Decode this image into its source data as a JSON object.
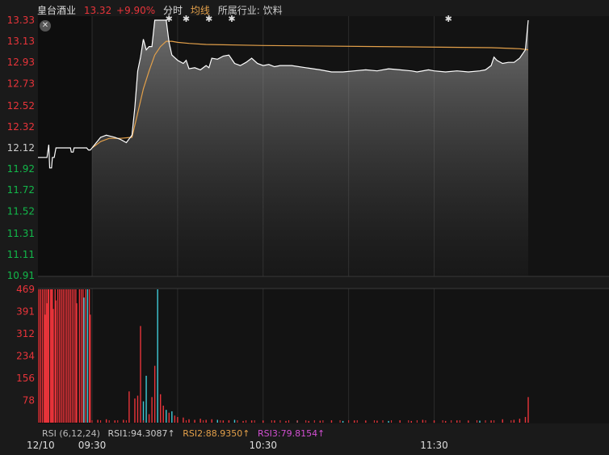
{
  "header": {
    "name": "皇台酒业",
    "price": "13.32",
    "change": "+9.90%",
    "mode": "分时",
    "avg_label": "均线",
    "industry": "所属行业: 饮料"
  },
  "rsi": {
    "label": "RSI (6,12,24)",
    "rsi1": "RSI1:94.3087↑",
    "rsi2": "RSI2:88.9350↑",
    "rsi3": "RSI3:79.8154↑"
  },
  "icons": {
    "close": "close-icon"
  },
  "colors": {
    "up": "#e8343a",
    "down": "#12b84a",
    "price": "#ffffff",
    "avg": "#e3a04a",
    "rsi1": "#cccccc",
    "rsi2": "#e3a04a",
    "rsi3": "#d24fd2",
    "volcyan": "#3fc9d6"
  },
  "chart_data": {
    "type": "line",
    "date_label": "12/10",
    "prev_close": "12.12",
    "y_ticks": [
      "13.33",
      "13.13",
      "12.93",
      "12.73",
      "12.52",
      "12.32",
      "12.12",
      "11.92",
      "11.72",
      "11.52",
      "11.31",
      "11.11",
      "10.91"
    ],
    "y_up": [
      "13.33",
      "13.13",
      "12.93",
      "12.73",
      "12.52",
      "12.32"
    ],
    "y_down": [
      "11.92",
      "11.72",
      "11.52",
      "11.31",
      "11.11",
      "10.91"
    ],
    "ylim": [
      10.91,
      13.33
    ],
    "x_ticks": [
      {
        "t": 0,
        "label": "09:30"
      },
      {
        "t": 60,
        "label": "10:30"
      },
      {
        "t": 120,
        "label": "11:30"
      }
    ],
    "pre_market": [
      [
        -60,
        12.03
      ],
      [
        -58,
        12.03
      ],
      [
        -56,
        12.03
      ],
      [
        -54,
        12.03
      ],
      [
        -52,
        12.03
      ],
      [
        -50,
        12.03
      ],
      [
        -48,
        12.15
      ],
      [
        -47,
        11.93
      ],
      [
        -45,
        11.93
      ],
      [
        -44,
        12.03
      ],
      [
        -42,
        12.03
      ],
      [
        -40,
        12.12
      ],
      [
        -38,
        12.12
      ],
      [
        -34,
        12.12
      ],
      [
        -30,
        12.12
      ],
      [
        -26,
        12.12
      ],
      [
        -24,
        12.12
      ],
      [
        -23,
        12.08
      ],
      [
        -21,
        12.08
      ],
      [
        -20,
        12.12
      ],
      [
        -18,
        12.12
      ],
      [
        -16,
        12.12
      ],
      [
        -14,
        12.12
      ],
      [
        -12,
        12.12
      ],
      [
        -10,
        12.12
      ],
      [
        -8,
        12.12
      ],
      [
        -6,
        12.12
      ],
      [
        -4,
        12.1
      ],
      [
        -2,
        12.1
      ],
      [
        0,
        12.12
      ]
    ],
    "price": [
      [
        0,
        12.12
      ],
      [
        3,
        12.22
      ],
      [
        5,
        12.24
      ],
      [
        8,
        12.22
      ],
      [
        10,
        12.2
      ],
      [
        12,
        12.17
      ],
      [
        14,
        12.24
      ],
      [
        15,
        12.5
      ],
      [
        16,
        12.85
      ],
      [
        17,
        12.98
      ],
      [
        18,
        13.15
      ],
      [
        19,
        13.05
      ],
      [
        20,
        13.08
      ],
      [
        21,
        13.08
      ],
      [
        22,
        13.33
      ],
      [
        24,
        13.33
      ],
      [
        26,
        13.33
      ],
      [
        27,
        13.12
      ],
      [
        28,
        13.0
      ],
      [
        30,
        12.95
      ],
      [
        32,
        12.92
      ],
      [
        33,
        12.95
      ],
      [
        34,
        12.87
      ],
      [
        36,
        12.88
      ],
      [
        38,
        12.86
      ],
      [
        40,
        12.9
      ],
      [
        41,
        12.88
      ],
      [
        42,
        12.97
      ],
      [
        44,
        12.96
      ],
      [
        46,
        12.99
      ],
      [
        48,
        13.0
      ],
      [
        50,
        12.92
      ],
      [
        52,
        12.9
      ],
      [
        54,
        12.93
      ],
      [
        56,
        12.97
      ],
      [
        58,
        12.92
      ],
      [
        60,
        12.9
      ],
      [
        62,
        12.91
      ],
      [
        64,
        12.89
      ],
      [
        66,
        12.9
      ],
      [
        70,
        12.9
      ],
      [
        75,
        12.88
      ],
      [
        80,
        12.86
      ],
      [
        84,
        12.84
      ],
      [
        88,
        12.84
      ],
      [
        92,
        12.85
      ],
      [
        96,
        12.86
      ],
      [
        100,
        12.85
      ],
      [
        104,
        12.87
      ],
      [
        108,
        12.86
      ],
      [
        112,
        12.85
      ],
      [
        114,
        12.84
      ],
      [
        118,
        12.86
      ],
      [
        120,
        12.85
      ],
      [
        124,
        12.84
      ],
      [
        128,
        12.85
      ],
      [
        132,
        12.84
      ],
      [
        136,
        12.85
      ],
      [
        138,
        12.86
      ],
      [
        140,
        12.9
      ],
      [
        141,
        12.98
      ],
      [
        142,
        12.95
      ],
      [
        144,
        12.92
      ],
      [
        146,
        12.93
      ],
      [
        148,
        12.93
      ],
      [
        150,
        12.97
      ],
      [
        152,
        13.05
      ],
      [
        153,
        13.33
      ]
    ],
    "avg": [
      [
        0,
        12.12
      ],
      [
        3,
        12.18
      ],
      [
        6,
        12.21
      ],
      [
        10,
        12.21
      ],
      [
        14,
        12.22
      ],
      [
        16,
        12.45
      ],
      [
        18,
        12.68
      ],
      [
        20,
        12.85
      ],
      [
        22,
        13.0
      ],
      [
        24,
        13.08
      ],
      [
        26,
        13.13
      ],
      [
        28,
        13.13
      ],
      [
        30,
        13.12
      ],
      [
        34,
        13.11
      ],
      [
        40,
        13.1
      ],
      [
        60,
        13.09
      ],
      [
        100,
        13.08
      ],
      [
        140,
        13.07
      ],
      [
        150,
        13.06
      ],
      [
        153,
        13.05
      ]
    ],
    "volume_ticks": [
      "469",
      "391",
      "312",
      "234",
      "156",
      "78"
    ],
    "volume_max": 469,
    "star_marks": [
      27,
      33,
      41,
      49,
      125
    ]
  }
}
